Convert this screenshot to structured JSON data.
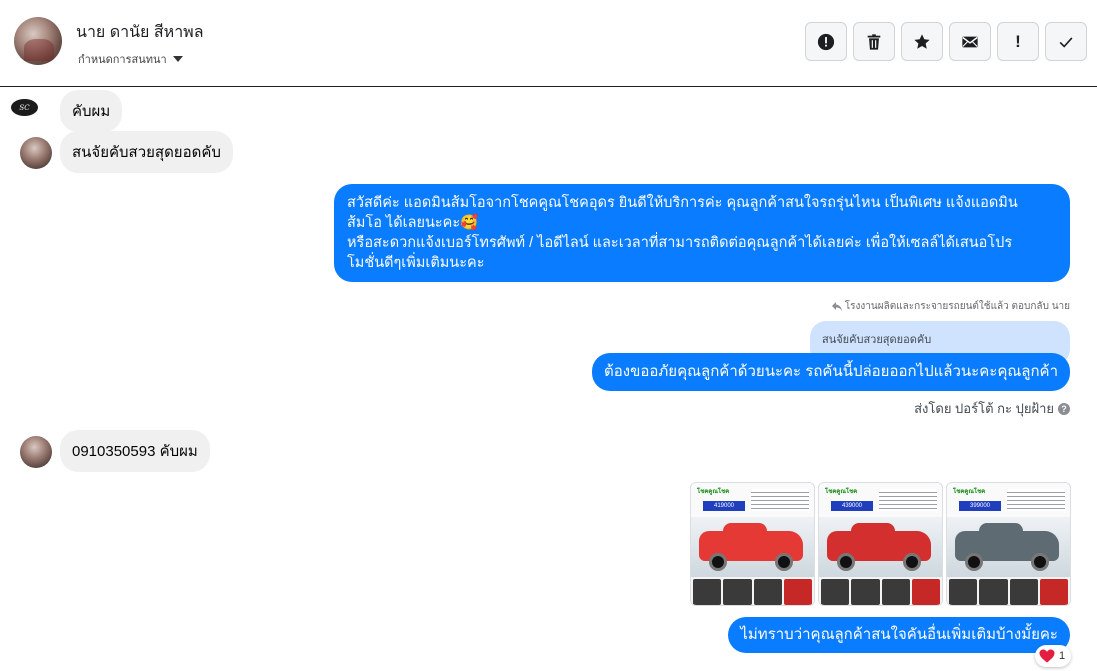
{
  "header": {
    "contact_name": "นาย ดานัย สีหาพล",
    "subtitle": "กำหนดการสนทนา",
    "toolbar": [
      {
        "icon": "alert-circle-icon",
        "label": ""
      },
      {
        "icon": "trash-icon",
        "label": ""
      },
      {
        "icon": "star-icon",
        "label": ""
      },
      {
        "icon": "envelope-icon",
        "label": ""
      },
      {
        "icon": "exclamation-icon",
        "label": "!"
      },
      {
        "icon": "check-icon",
        "label": ""
      }
    ]
  },
  "messages": {
    "m1": "คับผม",
    "m2": "สนจัยคับสวยสุดยอดคับ",
    "m3_line1": "สวัสดีค่ะ แอดมินส้มโอจากโชคคูณโชคอุดร ยินดีให้บริการค่ะ   คุณลูกค้าสนใจรถรุ่นไหน เป็นพิเศษ แจ้งแอดมิน",
    "m3_line2": "ส้มโอ ได้เลยนะคะ🥰",
    "m3_line3": "หรือสะดวกแจ้งเบอร์โทรศัพท์ / ไอดีไลน์ และเวลาที่สามารถติดต่อคุณลูกค้าได้เลยค่ะ เพื่อให้เซลล์ได้เสนอโปร",
    "m3_line4": "โมชั่นดีๆเพิ่มเติมนะคะ",
    "reply_meta": "โรงงานผลิตและกระจายรถยนต์ใช้แล้ว ตอบกลับ นาย",
    "quoted": "สนจัยคับสวยสุดยอดคับ",
    "m4": "ต้องขออภัยคุณลูกค้าด้วยนะคะ รถคันนี้ปล่อยออกไปแล้วนะคะคุณลูกค้า",
    "sent_by": "ส่งโดย ปอร์โต้ กะ ปุยฝ้าย",
    "m5": "0910350593 คับผม",
    "m6": "ไม่ทราบว่าคุณลูกค้าสนใจคันอื่นเพิ่มเติมบ้างมั้ยคะ",
    "reaction_count": "1"
  },
  "gallery": [
    {
      "price": "419000",
      "car_color": "#e53935"
    },
    {
      "price": "439000",
      "car_color": "#d32f2f"
    },
    {
      "price": "399000",
      "car_color": "#5f6b72"
    }
  ],
  "colors": {
    "outgoing_bubble": "#0a7cff",
    "incoming_bubble": "#f0f0f0",
    "quote_bubble": "#cfe3ff",
    "reaction_heart": "#e41e3f"
  }
}
